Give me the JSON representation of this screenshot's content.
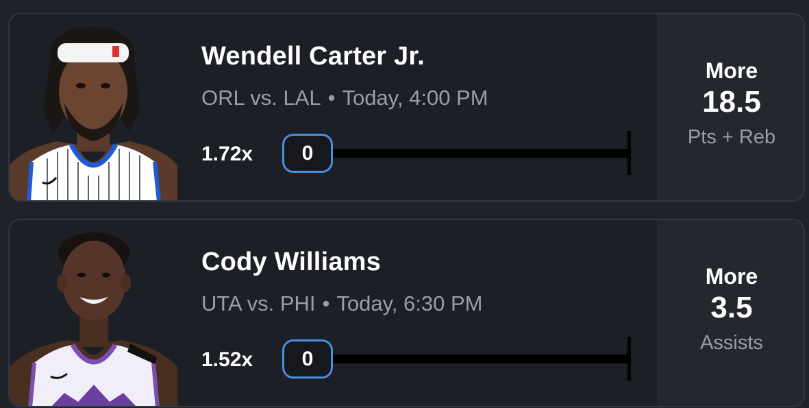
{
  "picks": [
    {
      "player_name": "Wendell Carter Jr.",
      "matchup": "ORL vs. LAL",
      "separator": "•",
      "game_time": "Today, 4:00 PM",
      "multiplier": "1.72x",
      "progress_value": "0",
      "direction": "More",
      "line": "18.5",
      "stat": "Pts + Reb",
      "jersey_color": "#ffffff",
      "jersey_trim": "#1f5bd6"
    },
    {
      "player_name": "Cody Williams",
      "matchup": "UTA vs. PHI",
      "separator": "•",
      "game_time": "Today, 6:30 PM",
      "multiplier": "1.52x",
      "progress_value": "0",
      "direction": "More",
      "line": "3.5",
      "stat": "Assists",
      "jersey_color": "#f2eef8",
      "jersey_trim": "#7a4fb0"
    }
  ],
  "colors": {
    "background": "#1f2228",
    "card": "#1c1f25",
    "card_border": "#33373f",
    "side_panel": "#24272d",
    "muted_text": "#9a9ea6",
    "accent_blue": "#4a8fe0"
  }
}
